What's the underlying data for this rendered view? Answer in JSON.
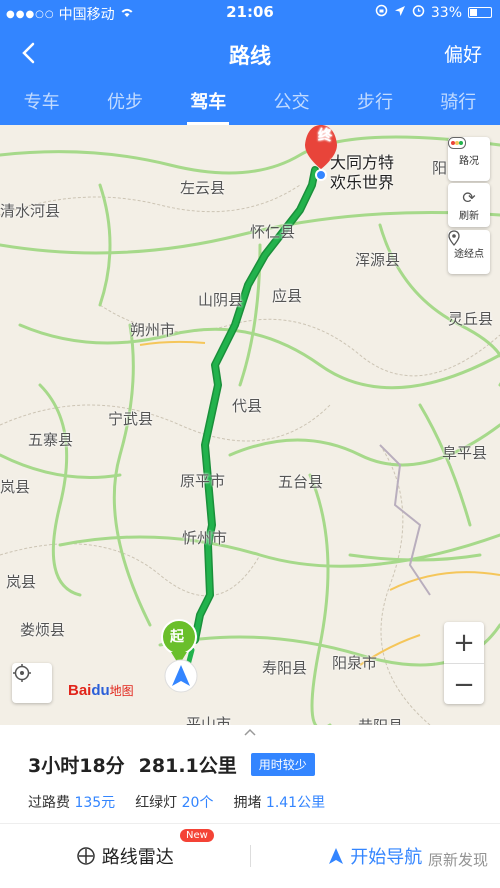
{
  "status_bar": {
    "carrier": "中国移动",
    "time": "21:06",
    "battery": "33%"
  },
  "nav": {
    "title": "路线",
    "preference": "偏好"
  },
  "tabs": [
    {
      "label": "专车"
    },
    {
      "label": "优步"
    },
    {
      "label": "驾车",
      "active": true
    },
    {
      "label": "公交"
    },
    {
      "label": "步行"
    },
    {
      "label": "骑行"
    }
  ],
  "map": {
    "destination_marker": "终",
    "destination_name_line1": "大同方特",
    "destination_name_line2": "欢乐世界",
    "start_marker": "起",
    "labels": [
      "左云县",
      "清水河县",
      "怀仁县",
      "浑源县",
      "山阴县",
      "应县",
      "朔州市",
      "灵丘县",
      "宁武县",
      "代县",
      "五寨县",
      "阜平县",
      "原平市",
      "五台县",
      "岚县",
      "忻州市",
      "岚县",
      "娄烦县",
      "寿阳县",
      "阳泉市",
      "平山市",
      "昔阳县",
      "阳"
    ],
    "controls": {
      "traffic": "路况",
      "refresh": "刷新",
      "waypoint": "途经点",
      "zoom_in": "+",
      "zoom_out": "−"
    },
    "logo": {
      "bai": "Bai",
      "du": "du",
      "cn": "地图"
    }
  },
  "route": {
    "duration": "3小时18分",
    "distance": "281.1公里",
    "tag": "用时较少",
    "toll_label": "过路费",
    "toll_value": "135元",
    "lights_label": "红绿灯",
    "lights_value": "20个",
    "jam_label": "拥堵",
    "jam_value": "1.41公里"
  },
  "actions": {
    "radar": "路线雷达",
    "new_badge": "New",
    "navigate": "开始导航"
  },
  "watermark": "原新发现",
  "colors": {
    "accent": "#3385ff",
    "route": "#22b24c",
    "marker_red": "#e8443a",
    "start_green": "#6abf2b"
  }
}
